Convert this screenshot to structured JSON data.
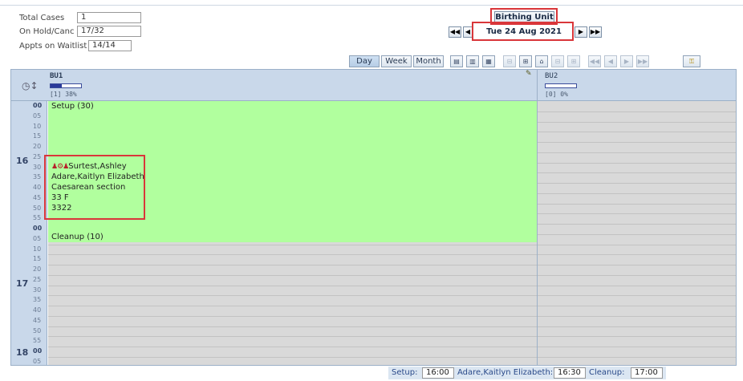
{
  "summary": {
    "total_cases_label": "Total Cases",
    "total_cases_value": "1",
    "onhold_label": "On Hold/Canc",
    "onhold_value": "17/32",
    "waitlist_label": "Appts on Waitlist",
    "waitlist_value": "14/14"
  },
  "header": {
    "unit_name": "Birthing Unit",
    "date": "Tue 24 Aug 2021",
    "nav_first": "◀◀",
    "nav_prev": "◀",
    "nav_next": "▶",
    "nav_last": "▶▶"
  },
  "toolbar": {
    "views": [
      "Day",
      "Week",
      "Month"
    ],
    "active_view": "Day"
  },
  "columns": [
    {
      "name": "BU1",
      "capacity": "[1] 38%",
      "fill_fraction": 0.38
    },
    {
      "name": "BU2",
      "capacity": "[0] 0%",
      "fill_fraction": 0.0
    }
  ],
  "times": {
    "hours": [
      "16",
      "17",
      "18"
    ],
    "minutes": [
      "00",
      "05",
      "10",
      "15",
      "20",
      "25",
      "30",
      "35",
      "40",
      "45",
      "50",
      "55",
      "00",
      "05",
      "10",
      "15",
      "20",
      "25",
      "30",
      "35",
      "40",
      "45",
      "50",
      "55",
      "00",
      "05"
    ]
  },
  "blocks": {
    "setup": "Setup (30)",
    "cleanup": "Cleanup (10)"
  },
  "appointment": {
    "icons": "♟⚙♟",
    "surgeon": "Surtest,Ashley",
    "patient": "Adare,Kaitlyn Elizabeth",
    "procedure": "Caesarean section",
    "age_sex": "33 F",
    "id": "3322"
  },
  "footer": {
    "setup_label": "Setup:",
    "setup_time": "16:00",
    "patient_label": "Adare,Kaitlyn Elizabeth:",
    "patient_time": "16:30",
    "cleanup_label": "Cleanup:",
    "cleanup_time": "17:00"
  },
  "colors": {
    "block_green": "#b1ff9e",
    "highlight_red": "#d9363a",
    "header_blue": "#c9d8ea"
  }
}
